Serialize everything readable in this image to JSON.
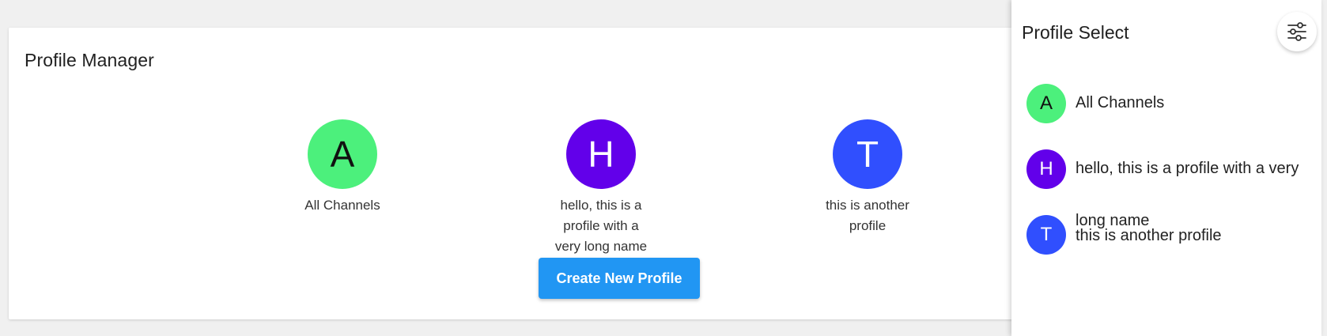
{
  "main": {
    "title": "Profile Manager",
    "profiles": [
      {
        "initial": "A",
        "name": "All Channels",
        "color": "#4cf07c",
        "text_color": "#111111"
      },
      {
        "initial": "H",
        "name": "hello, this is a profile with a very long name",
        "color": "#6200ea",
        "text_color": "#ffffff"
      },
      {
        "initial": "T",
        "name": "this is another profile",
        "color": "#304ffe",
        "text_color": "#ffffff"
      }
    ],
    "create_button_label": "Create New Profile",
    "button_color": "#2196f3"
  },
  "drawer": {
    "title": "Profile Select",
    "settings_icon": "sliders-icon",
    "items": [
      {
        "initial": "A",
        "label": "All Channels"
      },
      {
        "initial": "H",
        "label": "hello, this is a profile with a very"
      },
      {
        "initial": "T",
        "label_overflow": "long name",
        "label": "this is another profile"
      }
    ]
  }
}
